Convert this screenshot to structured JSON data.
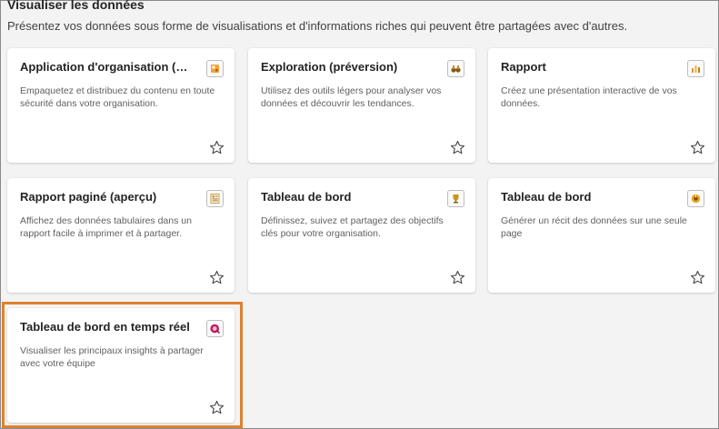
{
  "section": {
    "title": "Visualiser les données",
    "description": "Présentez vos données sous forme de visualisations et d'informations riches qui peuvent être partagées avec d'autres."
  },
  "cards": [
    {
      "title": "Application d'organisation (pr...",
      "description": "Empaquetez et distribuez du contenu en toute sécurité dans votre organisation.",
      "icon": "org-app-icon"
    },
    {
      "title": "Exploration (préversion)",
      "description": "Utilisez des outils légers pour analyser vos données et découvrir les tendances.",
      "icon": "binoculars-icon"
    },
    {
      "title": "Rapport",
      "description": "Créez une présentation interactive de vos données.",
      "icon": "report-chart-icon"
    },
    {
      "title": "Rapport paginé (aperçu)",
      "description": "Affichez des données tabulaires dans un rapport facile à imprimer et à partager.",
      "icon": "paginated-report-icon"
    },
    {
      "title": "Tableau de bord",
      "description": "Définissez, suivez et partagez des objectifs clés pour votre organisation.",
      "icon": "trophy-icon"
    },
    {
      "title": "Tableau de bord",
      "description": "Générer un récit des données sur une seule page",
      "icon": "dashboard-gauge-icon"
    },
    {
      "title": "Tableau de bord en temps réel",
      "description": "Visualiser les principaux insights à partager avec votre équipe",
      "icon": "realtime-dashboard-icon"
    }
  ],
  "colors": {
    "highlight": "#e0812f",
    "card_bg": "#ffffff",
    "page_bg": "#f3f3f3"
  }
}
